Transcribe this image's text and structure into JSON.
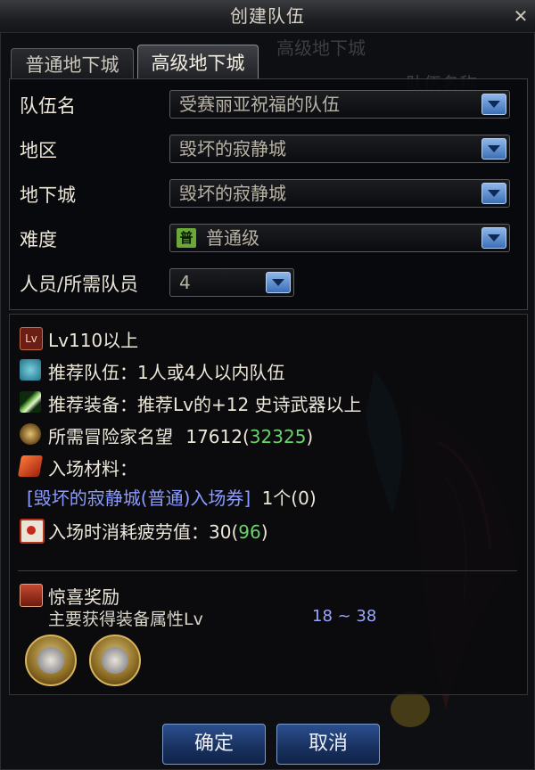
{
  "window": {
    "title": "创建队伍"
  },
  "tabs": [
    {
      "label": "普通地下城",
      "active": false
    },
    {
      "label": "高级地下城",
      "active": true
    }
  ],
  "background_ghost": {
    "text1": "高级地下城",
    "text2": "队伍名称"
  },
  "form": {
    "team_name": {
      "label": "队伍名",
      "value": "受赛丽亚祝福的队伍"
    },
    "region": {
      "label": "地区",
      "value": "毁坏的寂静城"
    },
    "dungeon": {
      "label": "地下城",
      "value": "毁坏的寂静城"
    },
    "difficulty": {
      "label": "难度",
      "badge": "普",
      "value": "普通级"
    },
    "members": {
      "label": "人员/所需队员",
      "value": "4"
    }
  },
  "info": {
    "level_icon_text": "Lv",
    "level": "Lv110以上",
    "team_recommend": "推荐队伍：1人或4人以内队伍",
    "equipment_recommend": "推荐装备：推荐Lv的+12 史诗武器以上",
    "fame_label": "所需冒险家名望",
    "fame_required": "17612",
    "fame_current": "32325",
    "material_label": "入场材料：",
    "material_ticket": "[毁坏的寂静城(普通)入场券]",
    "material_count": "1个(0)",
    "fatigue_label": "入场时消耗疲劳值：",
    "fatigue_cost": "30",
    "fatigue_current": "96"
  },
  "reward": {
    "title": "惊喜奖励",
    "attr_label": "主要获得装备属性Lv",
    "attr_range": "18 ~ 38"
  },
  "buttons": {
    "confirm": "确定",
    "cancel": "取消"
  },
  "colors": {
    "accent_blue": "#3a6fb7",
    "green_text": "#69d46b",
    "ticket_text": "#8a9cff"
  }
}
